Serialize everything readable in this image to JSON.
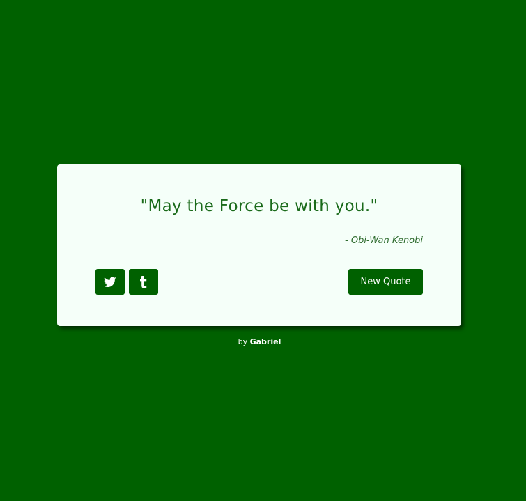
{
  "quote": {
    "text": "\"May the Force be with you.\"",
    "author": "- Obi-Wan Kenobi"
  },
  "actions": {
    "twitter_icon": "twitter-icon",
    "tumblr_icon": "tumblr-icon",
    "new_quote_label": "New Quote"
  },
  "footer": {
    "prefix": "by",
    "name": "Gabriel"
  },
  "colors": {
    "background": "#006100",
    "card": "#f5fff9",
    "text": "#1a6a1a",
    "button": "#006100"
  }
}
